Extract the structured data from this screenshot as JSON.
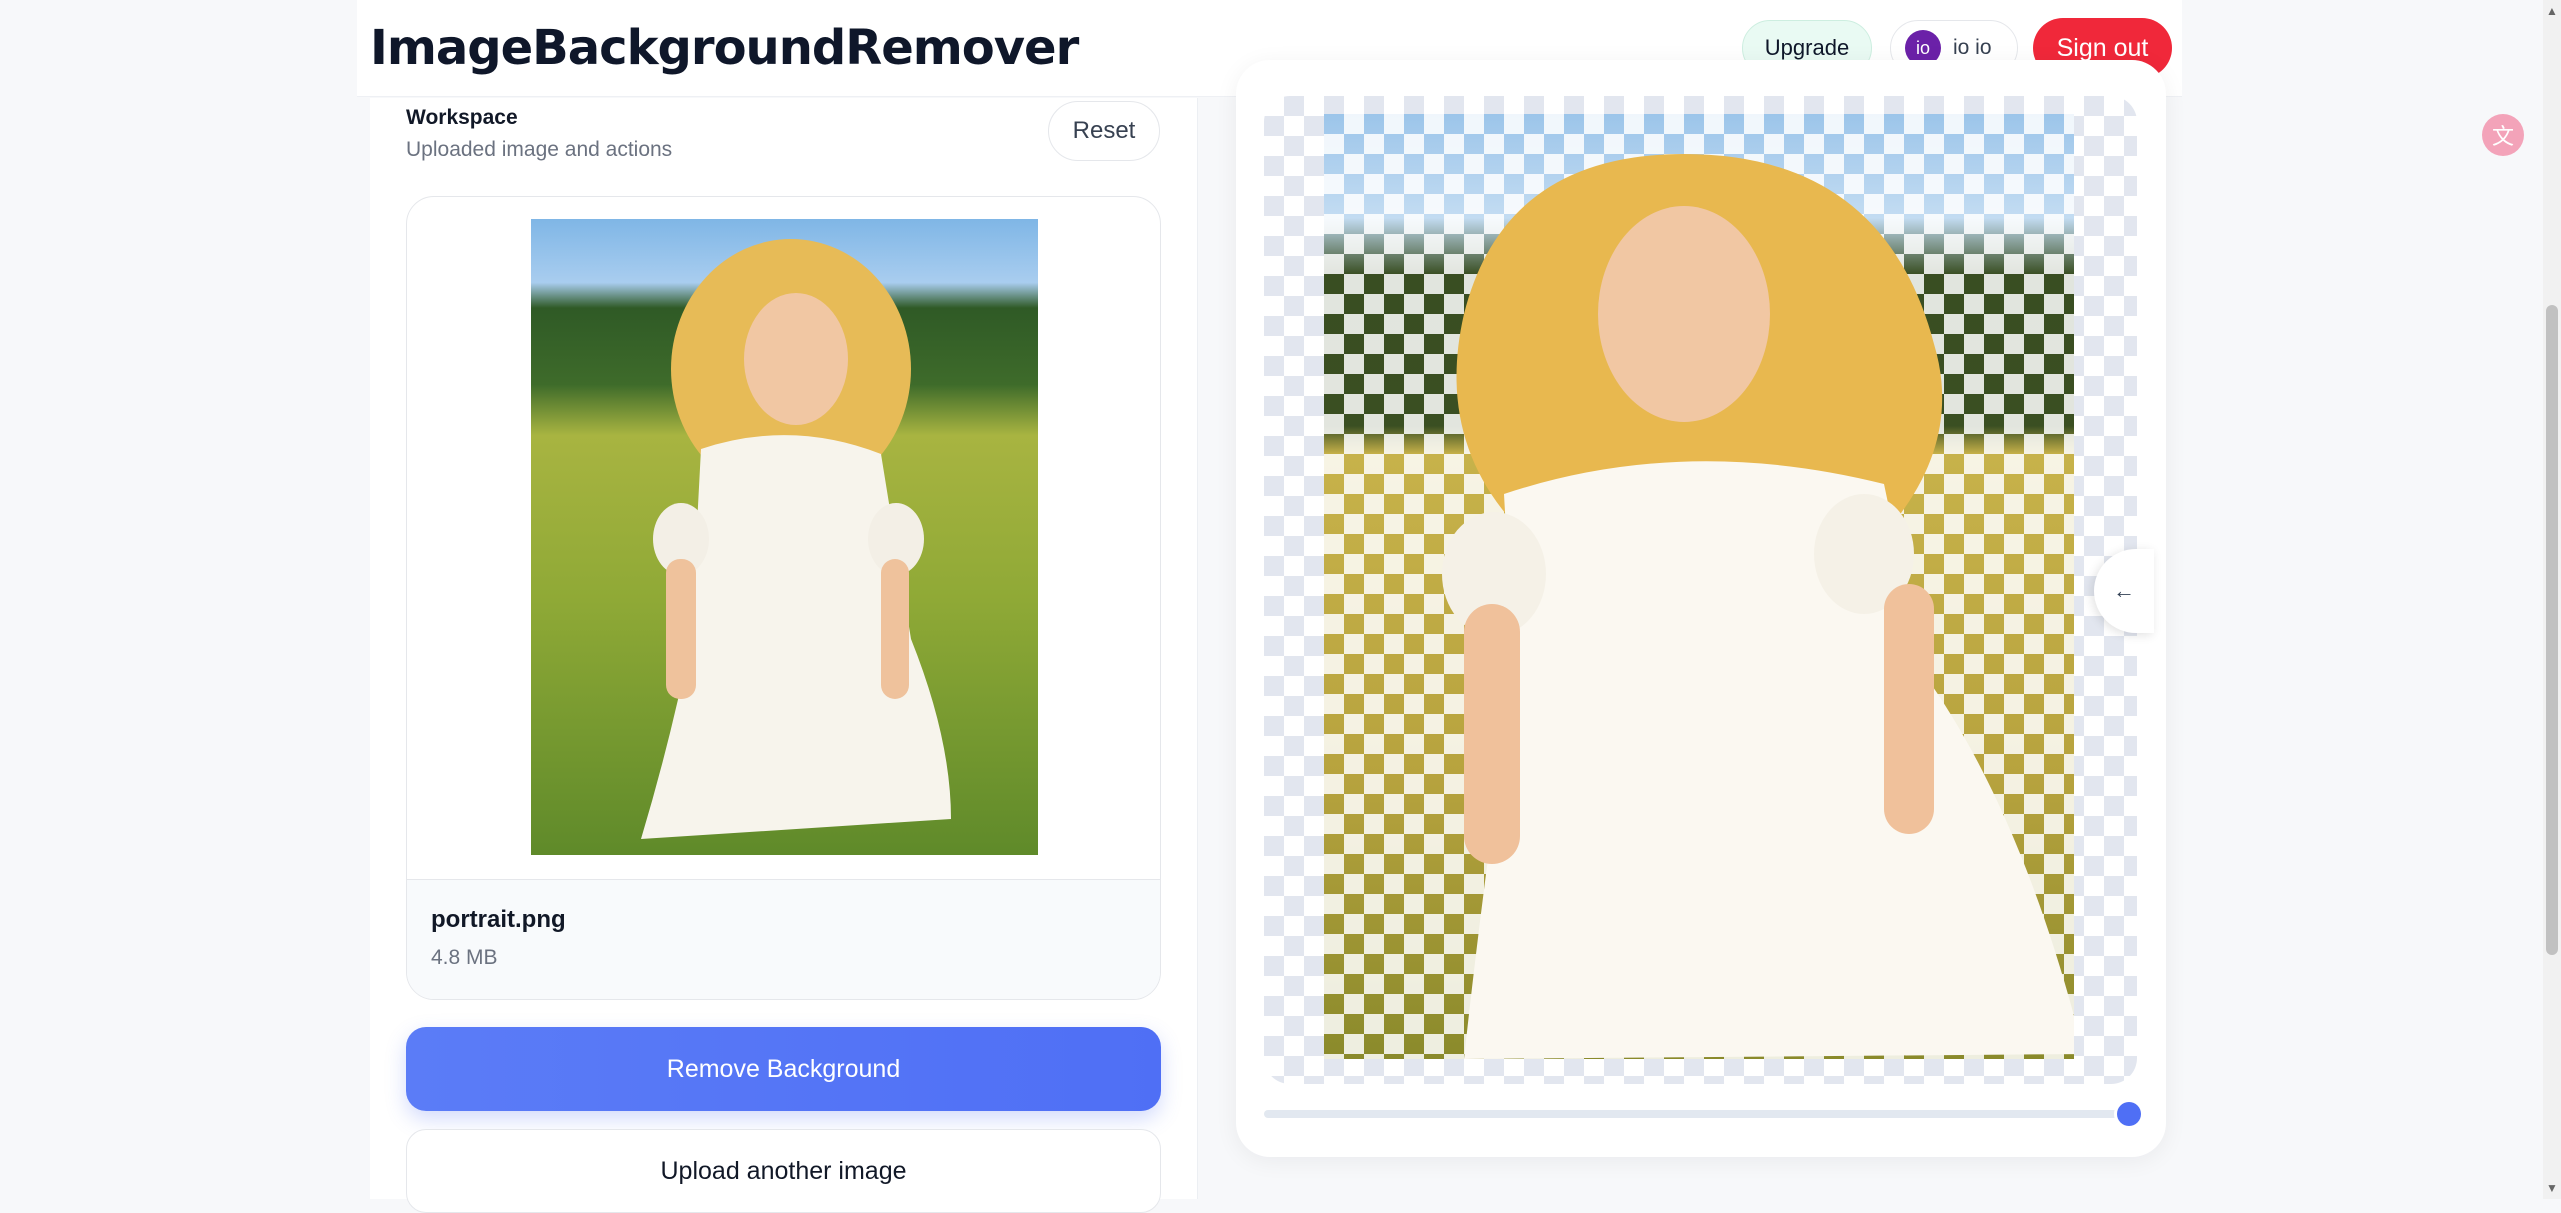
{
  "header": {
    "brand": "ImageBackgroundRemover",
    "upgrade_label": "Upgrade",
    "user": {
      "initials": "io",
      "name": "io io"
    },
    "signout_label": "Sign out"
  },
  "workspace": {
    "title": "Workspace",
    "subtitle": "Uploaded image and actions",
    "reset_label": "Reset",
    "file": {
      "name": "portrait.png",
      "size": "4.8 MB"
    },
    "remove_bg_label": "Remove Background",
    "upload_another_label": "Upload another image"
  },
  "result": {
    "handle_icon": "←",
    "slider_value_percent": 100
  },
  "colors": {
    "accent": "#4f6ff5",
    "signout": "#f0283a",
    "upgrade_bg": "#e9faf3"
  },
  "icons": {
    "translate": "translate-icon",
    "compare_handle": "arrow-left-icon"
  }
}
